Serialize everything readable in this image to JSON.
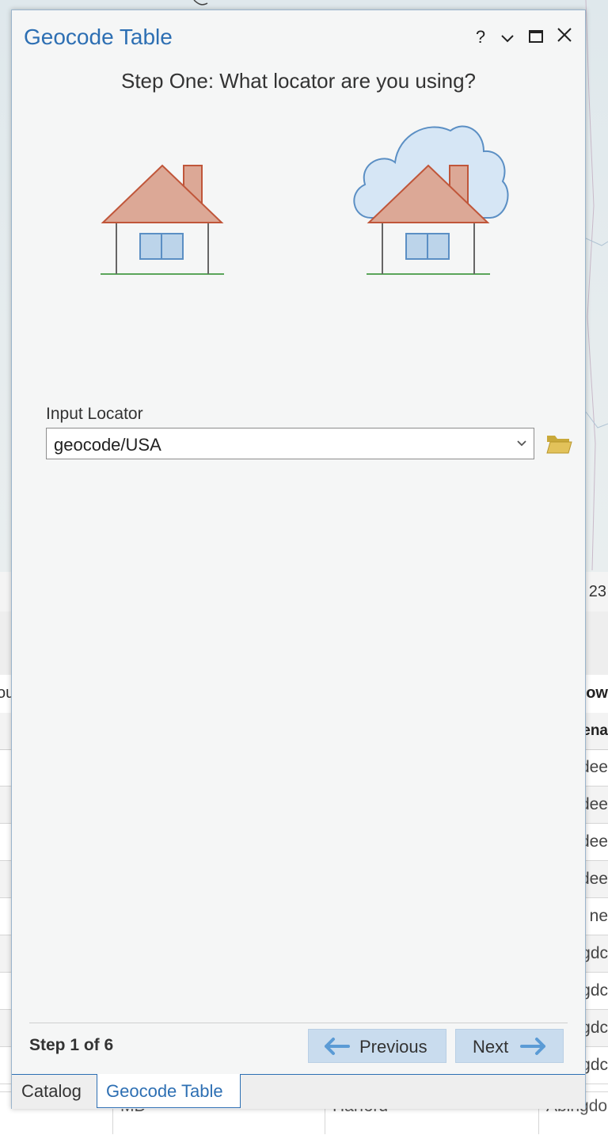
{
  "pane": {
    "title": "Geocode Table",
    "controls": {
      "help": "?",
      "menu": "⌄",
      "maximize": "▭",
      "close": "✕"
    },
    "step_heading": "Step One: What locator are you using?",
    "input_locator": {
      "label": "Input Locator",
      "value": "geocode/USA"
    },
    "footer": {
      "step": "Step 1 of 6",
      "previous_label": "Previous",
      "next_label": "Next"
    },
    "tabs": [
      {
        "label": "Catalog"
      },
      {
        "label": "Geocode Table"
      }
    ]
  },
  "background": {
    "status_partial": "23",
    "header_left_partial": "ou",
    "header_right_partial": "ow",
    "subheader_partial": "ena",
    "row_partials": [
      "dee",
      "dee",
      "dee",
      "dee",
      "ne",
      "gdc",
      "gdc",
      "gdc",
      "gdc"
    ],
    "bottom_row": {
      "c1": "MD",
      "c2": "Harford",
      "c3": "Abingdo"
    }
  },
  "colors": {
    "accent": "#2d6fb3",
    "house_roof": "#dca896",
    "house_roof_stroke": "#c0563a",
    "window_fill": "#bcd4ea",
    "window_stroke": "#5b8fc4",
    "ground": "#5aa55a",
    "cloud_fill": "#d6e6f5",
    "cloud_stroke": "#5b8fc4",
    "folder": "#e2c25a",
    "button_bg": "#c9dcee",
    "arrow": "#5b9bd5"
  }
}
